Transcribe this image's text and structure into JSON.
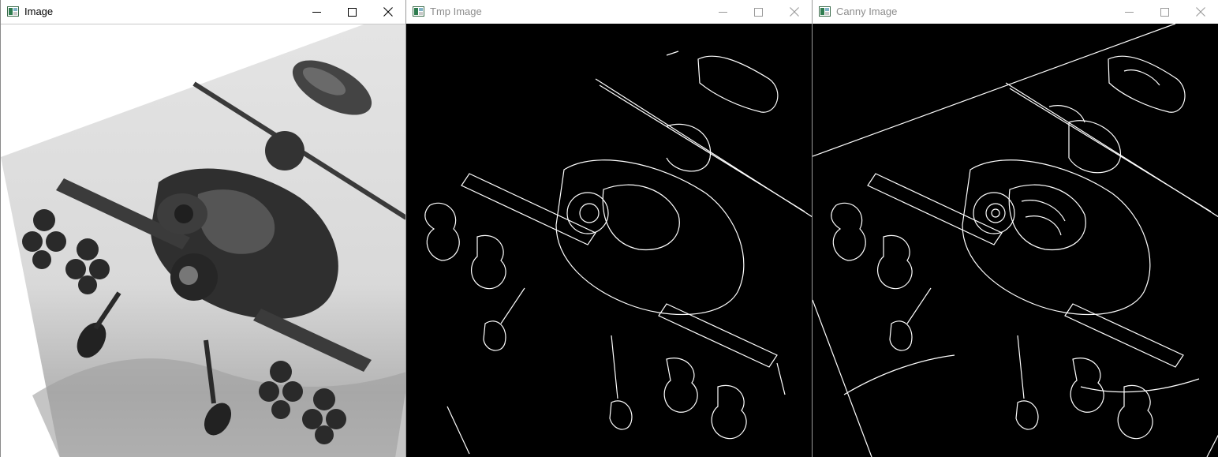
{
  "windows": [
    {
      "title": "Image",
      "active": true
    },
    {
      "title": "Tmp Image",
      "active": false
    },
    {
      "title": "Canny Image",
      "active": false
    }
  ],
  "controls": {
    "minimize_icon": "minimize-icon",
    "maximize_icon": "maximize-icon",
    "close_icon": "close-icon"
  },
  "colors": {
    "edge_background": "#000000",
    "edge_lines": "#ffffff",
    "active_title": "#000000",
    "inactive_title": "#8c8c8c"
  }
}
